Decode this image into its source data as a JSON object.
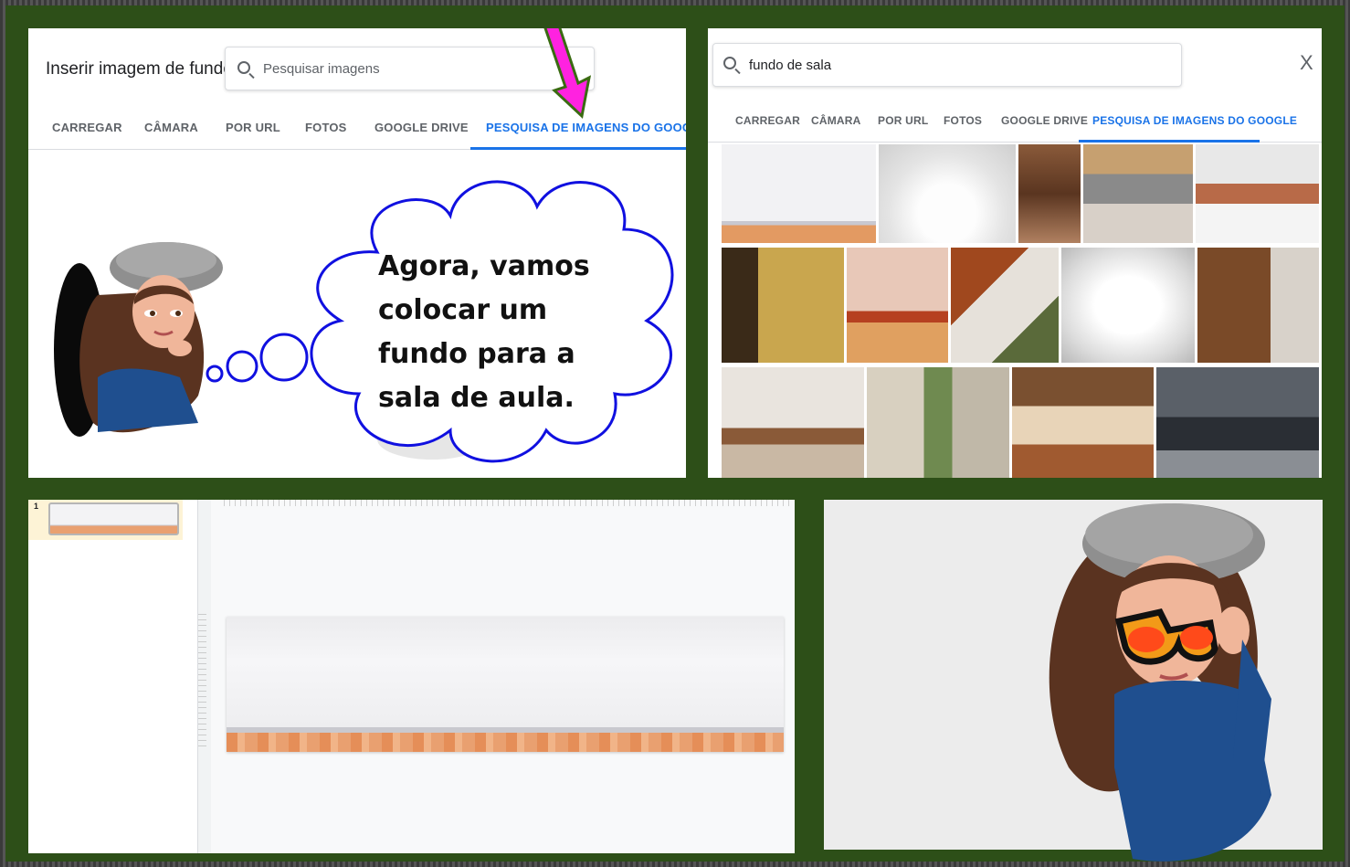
{
  "panel_background_dialog": {
    "title": "Inserir imagem de fundo",
    "search_placeholder": "Pesquisar imagens",
    "tabs": [
      {
        "label": "CARREGAR",
        "active": false
      },
      {
        "label": "CÂMARA",
        "active": false
      },
      {
        "label": "POR URL",
        "active": false
      },
      {
        "label": "FOTOS",
        "active": false
      },
      {
        "label": "GOOGLE DRIVE",
        "active": false
      },
      {
        "label": "PESQUISA DE IMAGENS DO GOOGLE",
        "active": true
      }
    ],
    "speech": "Agora, vamos colocar um fundo para a sala de aula.",
    "arrow_color": "#ff22e0"
  },
  "panel_search_results": {
    "search_value": "fundo de sala",
    "close_label": "X",
    "tabs": [
      {
        "label": "CARREGAR",
        "active": false
      },
      {
        "label": "CÂMARA",
        "active": false
      },
      {
        "label": "POR URL",
        "active": false
      },
      {
        "label": "FOTOS",
        "active": false
      },
      {
        "label": "GOOGLE DRIVE",
        "active": false
      },
      {
        "label": "PESQUISA DE IMAGENS DO GOOGLE",
        "active": true
      }
    ]
  },
  "panel_slides": {
    "slide_number": "1"
  },
  "colors": {
    "accent_blue": "#1a73e8",
    "frame_green": "#2d4f18",
    "floor_orange": "#e9a070"
  }
}
